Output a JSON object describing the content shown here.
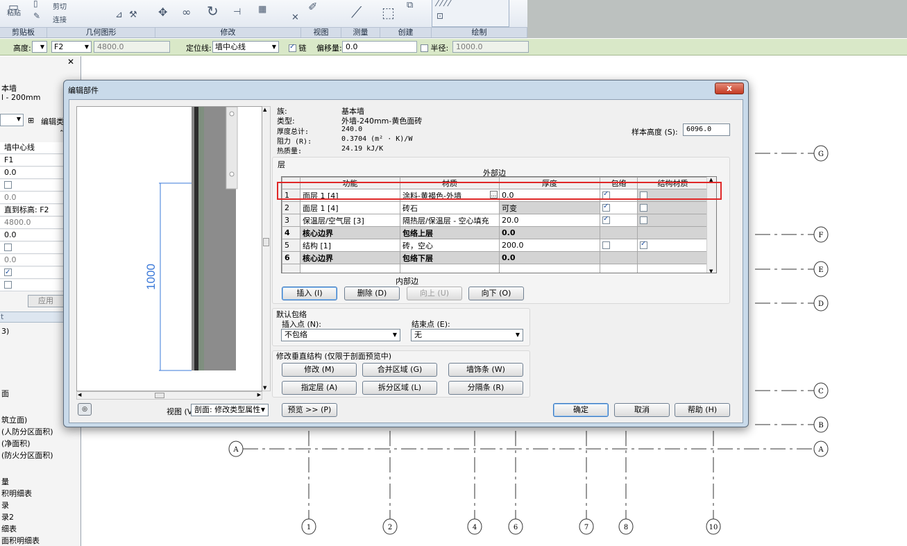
{
  "ribbon": {
    "groups": [
      "剪贴板",
      "几何图形",
      "修改",
      "视图",
      "测量",
      "创建",
      "绘制"
    ],
    "small_labels": {
      "paste": "粘贴",
      "cut": "剪切",
      "join": "连接"
    }
  },
  "optbar": {
    "height_label": "高度:",
    "height_value": "F2",
    "height_num": "4800.0",
    "locline_label": "定位线:",
    "locline_value": "墙中心线",
    "chain_label": "链",
    "offset_label": "偏移量:",
    "offset_value": "0.0",
    "radius_label": "半径:",
    "radius_value": "1000.0"
  },
  "left": {
    "type_line1": "本墙",
    "type_line2": "l - 200mm",
    "edit_type": "编辑类",
    "rows": [
      "墙中心线",
      "F1",
      "0.0",
      "",
      "0.0",
      "直到标高: F2",
      "4800.0",
      "0.0",
      "",
      "0.0",
      "",
      ""
    ],
    "apply": "应用",
    "browser_head": "t",
    "browser_items": [
      "3)",
      "面",
      "筑立面)",
      "(人防分区面积)",
      "(净面积)",
      "(防火分区面积)",
      "量",
      "积明细表",
      "录",
      "录2",
      "细表",
      "面积明细表"
    ]
  },
  "grid": {
    "row_labels": [
      "G",
      "F",
      "E",
      "D",
      "C",
      "B",
      "A"
    ],
    "col_labels": [
      "1",
      "2",
      "4",
      "6",
      "7",
      "8",
      "10"
    ]
  },
  "dialog": {
    "title": "编辑部件",
    "close": "x",
    "info": {
      "family_label": "族:",
      "family_value": "基本墙",
      "type_label": "类型:",
      "type_value": "外墙-240mm-黄色面砖",
      "total_label": "厚度总计:",
      "total_value": "240.0",
      "resist_label": "阻力 (R):",
      "resist_value": "0.3704 (m² · K)/W",
      "mass_label": "热质量:",
      "mass_value": "24.19 kJ/K",
      "sample_label": "样本高度 (S):",
      "sample_value": "6096.0"
    },
    "layers": {
      "group_label": "层",
      "exterior": "外部边",
      "interior": "内部边",
      "headers": [
        "功能",
        "材质",
        "厚度",
        "包络",
        "结构材质"
      ],
      "rows": [
        {
          "n": "1",
          "func": "面层 1 [4]",
          "mat": "涂料-黄褐色-外墙",
          "thk": "0.0"
        },
        {
          "n": "2",
          "func": "面层 1 [4]",
          "mat": "砖石",
          "thk": "可变"
        },
        {
          "n": "3",
          "func": "保温层/空气层 [3]",
          "mat": "隔热层/保温层 - 空心填充",
          "thk": "20.0"
        },
        {
          "n": "4",
          "func": "核心边界",
          "mat": "包络上层",
          "thk": "0.0"
        },
        {
          "n": "5",
          "func": "结构 [1]",
          "mat": "砖，空心",
          "thk": "200.0"
        },
        {
          "n": "6",
          "func": "核心边界",
          "mat": "包络下层",
          "thk": "0.0"
        }
      ]
    },
    "buttons": {
      "insert": "插入 (I)",
      "delete": "删除 (D)",
      "up": "向上 (U)",
      "down": "向下 (O)"
    },
    "wrap": {
      "label": "默认包络",
      "insert_label": "插入点 (N):",
      "insert_value": "不包络",
      "end_label": "结束点 (E):",
      "end_value": "无"
    },
    "vertical": {
      "label": "修改垂直结构 (仅限于剖面预览中)",
      "modify": "修改 (M)",
      "merge": "合并区域 (G)",
      "sweep": "墙饰条 (W)",
      "assign": "指定层 (A)",
      "split": "拆分区域 (L)",
      "reveal": "分隔条 (R)"
    },
    "footer": {
      "view_label": "视图 (V):",
      "view_value": "剖面: 修改类型属性",
      "preview": "预览 >> (P)",
      "ok": "确定",
      "cancel": "取消",
      "help": "帮助 (H)"
    },
    "preview_dim": "1000"
  },
  "colors": {
    "highlight": "#e02828",
    "dim_line": "#3a78d8",
    "optbar_bg": "#d9e8c8"
  }
}
